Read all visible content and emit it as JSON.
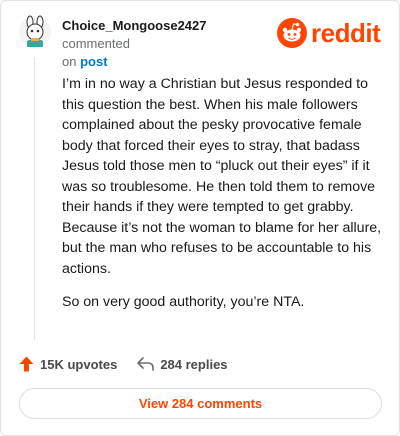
{
  "comment": {
    "username": "Choice_Mongoose2427",
    "action": "commented",
    "on_text": "on",
    "post_link": "post",
    "paragraphs": [
      "I’m in no way a Christian but Jesus responded to this question the best. When his male followers complained about the pesky provocative female body that forced their eyes to stray, that badass Jesus told those men to “pluck out their eyes” if it was so troublesome. He then told them to remove their hands if they were tempted to get grabby. Because it’s not the woman to blame for her allure, but the man who refuses to be accountable to his actions.",
      "So on very good authority, you’re NTA."
    ]
  },
  "brand": {
    "name": "reddit",
    "color": "#ff4500"
  },
  "stats": {
    "upvotes": "15K upvotes",
    "replies": "284 replies"
  },
  "view_button": "View 284 comments",
  "icons": [
    "snoo-avatar-icon",
    "reddit-logo-icon",
    "upvote-arrow-icon",
    "reply-arrow-icon"
  ]
}
